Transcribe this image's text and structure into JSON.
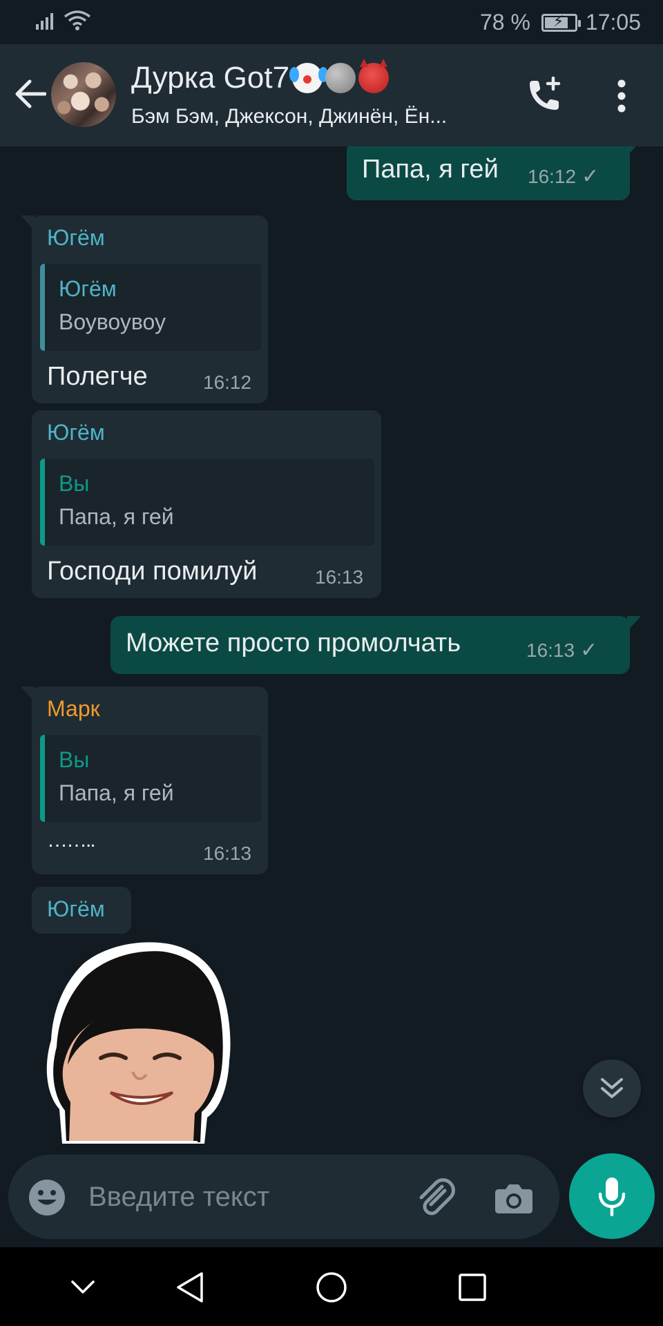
{
  "status_bar": {
    "battery_percent": "78 %",
    "battery_level": 0.78,
    "time": "17:05"
  },
  "header": {
    "title": "Дурка Got7",
    "title_emojis": [
      "clown-face-emoji",
      "new-moon-face-emoji",
      "ogre-emoji"
    ],
    "subtitle": "Бэм Бэм, Джексон, Джинён, Ён..."
  },
  "messages": [
    {
      "direction": "out",
      "text": "Папа, я гей",
      "time": "16:12",
      "status": "sent"
    },
    {
      "direction": "in",
      "sender": "Югём",
      "sender_color": "#4fb4c8",
      "quote": {
        "author": "Югём",
        "author_color": "#4fb4c8",
        "text": "Воувоувоу"
      },
      "text": "Полегче",
      "time": "16:12"
    },
    {
      "direction": "in",
      "sender": "Югём",
      "sender_color": "#4fb4c8",
      "quote": {
        "author": "Вы",
        "author_color": "#0e9a88",
        "text": "Папа, я гей"
      },
      "text": "Господи помилуй",
      "time": "16:13"
    },
    {
      "direction": "out",
      "text": "Можете просто промолчать",
      "time": "16:13",
      "status": "sent"
    },
    {
      "direction": "in",
      "sender": "Марк",
      "sender_color": "#f09a2b",
      "quote": {
        "author": "Вы",
        "author_color": "#0e9a88",
        "text": "Папа, я гей"
      },
      "text": "……..",
      "time": "16:13"
    },
    {
      "direction": "in",
      "sender": "Югём",
      "sender_color": "#4fb4c8",
      "type": "sticker",
      "sticker": "smiling-face-sticker"
    }
  ],
  "composer": {
    "placeholder": "Введите текст"
  },
  "icons": {
    "back": "back-arrow-icon",
    "add_call": "add-call-icon",
    "menu": "more-vert-icon",
    "emoji": "emoji-icon",
    "attach": "paperclip-icon",
    "camera": "camera-icon",
    "mic": "mic-icon",
    "scroll_down": "double-chevron-down-icon"
  },
  "colors": {
    "background": "#121b22",
    "header": "#1f2c34",
    "outgoing_bubble": "#0b4a44",
    "incoming_bubble": "#1f2c34",
    "accent": "#0aa593"
  }
}
